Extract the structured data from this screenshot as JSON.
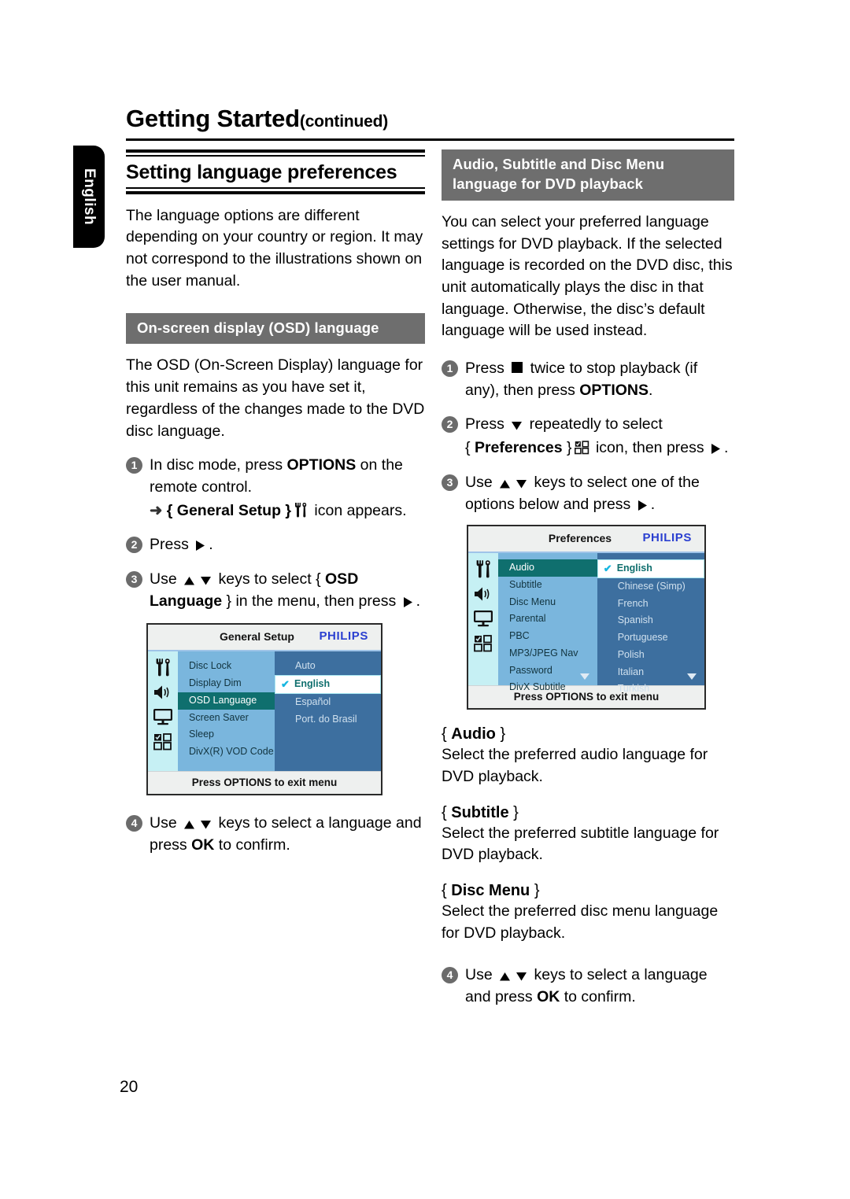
{
  "page": {
    "running_head": "Getting Started",
    "running_head_suffix": "(continued)",
    "side_tab": "English",
    "page_number": "20"
  },
  "left_column": {
    "section_title": "Setting language preferences",
    "intro": "The language options are different depending on your country or region. It may not correspond to the illustrations shown on the user manual.",
    "banner": "On-screen display (OSD) language",
    "body": "The OSD (On-Screen Display) language for this unit remains as you have set it, regardless of the changes made to the DVD disc language.",
    "steps": [
      {
        "num": "1",
        "text_a": "In disc mode, press ",
        "bold_a": "OPTIONS",
        "text_b": " on the remote control.",
        "sub_arrow": "➜",
        "sub_a": "{ ",
        "sub_bold": "General Setup",
        "sub_b": " }",
        "sub_c": " icon appears."
      },
      {
        "num": "2",
        "text_a": "Press ",
        "text_b": "."
      },
      {
        "num": "3",
        "text_a": "Use ",
        "text_b": " keys to select { ",
        "bold_a": "OSD Language",
        "text_c": " } in the menu, then press ",
        "text_d": "."
      },
      {
        "num": "4",
        "text_a": "Use ",
        "text_b": " keys to select a language and press ",
        "bold_a": "OK",
        "text_c": " to confirm."
      }
    ],
    "osd": {
      "title": "General Setup",
      "brand": "PHILIPS",
      "menu_items": [
        "Disc Lock",
        "Display Dim",
        "OSD Language",
        "Screen Saver",
        "Sleep",
        "DivX(R) VOD Code"
      ],
      "selected_menu_item": "OSD Language",
      "options": [
        "Auto",
        "English",
        "Español",
        "Port. do Brasil"
      ],
      "selected_option": "English",
      "footer_a": "Press ",
      "footer_bold": "OPTIONS",
      "footer_b": " to exit menu",
      "rail_icons": [
        "tools-icon",
        "speaker-icon",
        "tv-icon",
        "grid-icon"
      ]
    }
  },
  "right_column": {
    "banner_line1": "Audio, Subtitle and Disc Menu",
    "banner_line2": "language for DVD playback",
    "intro": "You can select your preferred language settings for DVD playback. If the selected language is recorded on the DVD disc, this unit automatically plays the disc in that language. Otherwise, the disc’s default language will be used instead.",
    "steps": [
      {
        "num": "1",
        "text_a": "Press ",
        "text_b": " twice to stop playback (if any), then press ",
        "bold_a": "OPTIONS",
        "text_c": "."
      },
      {
        "num": "2",
        "text_a": "Press ",
        "text_b": " repeatedly to select",
        "sub_a": "{ ",
        "sub_bold": "Preferences",
        "sub_b": " }",
        "sub_c": " icon, then press ",
        "sub_d": "."
      },
      {
        "num": "3",
        "text_a": "Use ",
        "text_b": " keys to select one of the options below and press ",
        "text_c": "."
      },
      {
        "num": "4",
        "text_a": "Use ",
        "text_b": " keys to select a language and press ",
        "bold_a": "OK",
        "text_c": " to confirm."
      }
    ],
    "osd": {
      "title": "Preferences",
      "brand": "PHILIPS",
      "menu_items": [
        "Audio",
        "Subtitle",
        "Disc Menu",
        "Parental",
        "PBC",
        "MP3/JPEG Nav",
        "Password",
        "DivX Subtitle"
      ],
      "selected_menu_item": "Audio",
      "options": [
        "English",
        "Chinese (Simp)",
        "French",
        "Spanish",
        "Portuguese",
        "Polish",
        "Italian",
        "Turkish"
      ],
      "selected_option": "English",
      "footer_a": "Press ",
      "footer_bold": "OPTIONS",
      "footer_b": " to exit menu",
      "rail_icons": [
        "tools-icon",
        "speaker-icon",
        "tv-icon",
        "grid-icon"
      ]
    },
    "options_desc": [
      {
        "open": "{ ",
        "name": "Audio",
        "close": " }",
        "body": "Select the preferred audio language for DVD playback."
      },
      {
        "open": "{ ",
        "name": "Subtitle",
        "close": " }",
        "body": "Select the preferred subtitle language for DVD playback."
      },
      {
        "open": "{ ",
        "name": "Disc Menu",
        "close": " }",
        "body": "Select the preferred disc menu language for DVD playback."
      }
    ]
  },
  "colors": {
    "banner_gray": "#6e6e6e",
    "step_circle": "#6b6b6b",
    "philips_blue": "#2a3fd0",
    "osd_rail": "#c6f0f4",
    "osd_mid": "#7ab6dd",
    "osd_right": "#3d6f9f",
    "osd_highlight": "#0f6f6e",
    "check_cyan": "#17b6e0"
  }
}
